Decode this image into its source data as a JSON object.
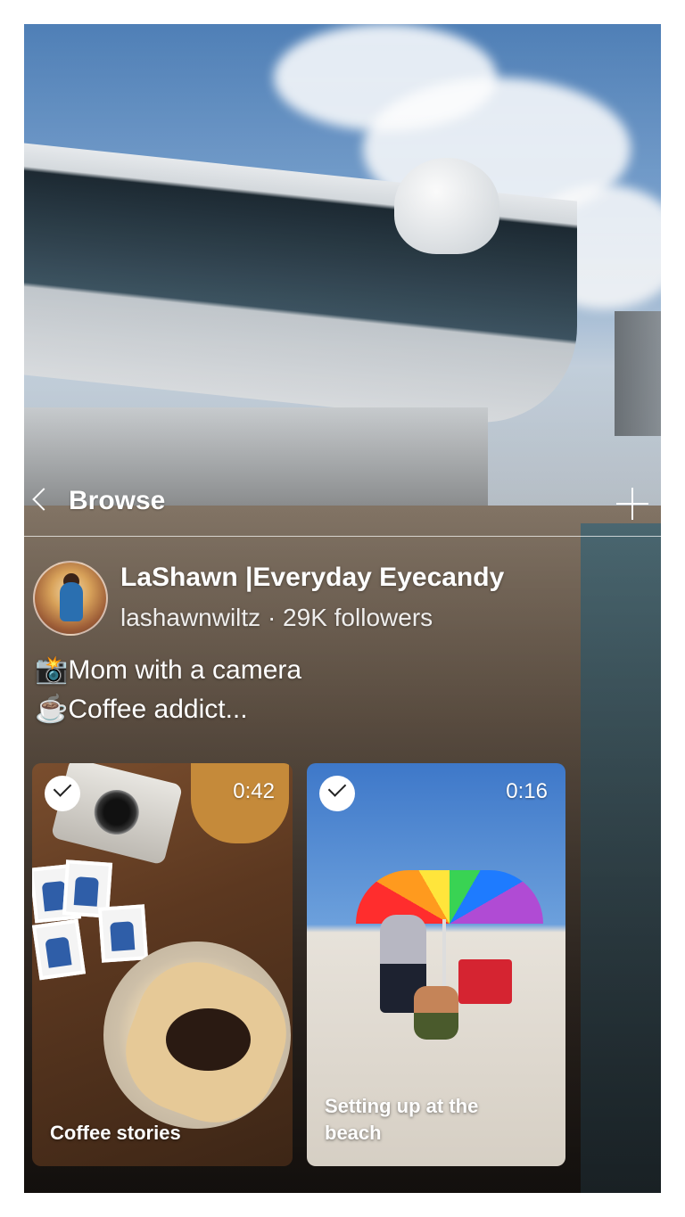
{
  "nav": {
    "back_label": "Browse",
    "back_icon": "chevron-left-icon",
    "add_icon": "plus-icon"
  },
  "profile": {
    "name": "LaShawn |Everyday Eyecandy",
    "meta": "lashawnwiltz · 29K followers",
    "bio": [
      "📸Mom with a camera",
      "☕Coffee addict..."
    ]
  },
  "videos": [
    {
      "title": "Coffee stories",
      "duration": "0:42",
      "selected": true
    },
    {
      "title": "Setting up at the beach",
      "duration": "0:16",
      "selected": true
    }
  ],
  "colors": {
    "text": "#ffffff",
    "check_bg": "#ffffff"
  }
}
